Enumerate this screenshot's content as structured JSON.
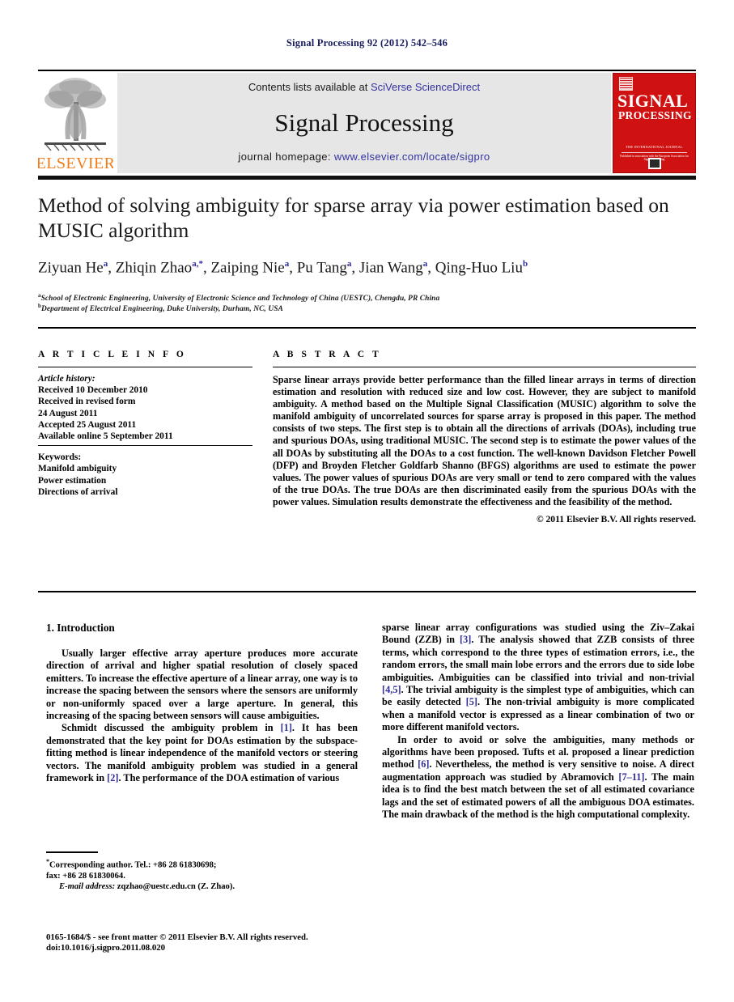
{
  "running_head": "Signal Processing 92 (2012) 542–546",
  "banner": {
    "publisher_word": "ELSEVIER",
    "contents_prefix": "Contents lists available at ",
    "contents_link": "SciVerse ScienceDirect",
    "journal_name": "Signal Processing",
    "homepage_prefix": "journal homepage: ",
    "homepage_url": "www.elsevier.com/locate/sigpro",
    "cover": {
      "title_line1": "SIGNAL",
      "title_line2": "PROCESSING",
      "sub_line1": "THE INTERNATIONAL JOURNAL",
      "sub_line2": "Published in association with the European Association for Signal Processing"
    },
    "link_color": "#3232a0",
    "cover_color": "#cf1111",
    "elsevier_orange": "#f07d1a"
  },
  "article": {
    "title": "Method of solving ambiguity for sparse array via power estimation based on MUSIC algorithm",
    "authors": [
      {
        "name": "Ziyuan He",
        "marks": "a"
      },
      {
        "name": "Zhiqin Zhao",
        "marks": "a,*"
      },
      {
        "name": "Zaiping Nie",
        "marks": "a"
      },
      {
        "name": "Pu Tang",
        "marks": "a"
      },
      {
        "name": "Jian Wang",
        "marks": "a"
      },
      {
        "name": "Qing-Huo Liu",
        "marks": "b"
      }
    ],
    "affiliations": [
      {
        "mark": "a",
        "text": "School of Electronic Engineering, University of Electronic Science and Technology of China (UESTC), Chengdu, PR China"
      },
      {
        "mark": "b",
        "text": "Department of Electrical Engineering, Duke University, Durham, NC, USA"
      }
    ]
  },
  "info": {
    "heading": "A R T I C L E  I N F O",
    "history_label": "Article history:",
    "history": [
      "Received 10 December 2010",
      "Received in revised form",
      "24 August 2011",
      "Accepted 25 August 2011",
      "Available online 5 September 2011"
    ],
    "keywords_label": "Keywords:",
    "keywords": [
      "Manifold ambiguity",
      "Power estimation",
      "Directions of arrival"
    ]
  },
  "abstract": {
    "heading": "A B S T R A C T",
    "text": "Sparse linear arrays provide better performance than the filled linear arrays in terms of direction estimation and resolution with reduced size and low cost. However, they are subject to manifold ambiguity. A method based on the Multiple Signal Classification (MUSIC) algorithm to solve the manifold ambiguity of uncorrelated sources for sparse array is proposed in this paper. The method consists of two steps. The first step is to obtain all the directions of arrivals (DOAs), including true and spurious DOAs, using traditional MUSIC. The second step is to estimate the power values of the all DOAs by substituting all the DOAs to a cost function. The well-known Davidson Fletcher Powell (DFP) and Broyden Fletcher Goldfarb Shanno (BFGS) algorithms are used to estimate the power values. The power values of spurious DOAs are very small or tend to zero compared with the values of the true DOAs. The true DOAs are then discriminated easily from the spurious DOAs with the power values. Simulation results demonstrate the effectiveness and the feasibility of the method.",
    "copyright": "© 2011 Elsevier B.V. All rights reserved."
  },
  "body": {
    "section_number_title": "1.  Introduction",
    "left_paragraphs": [
      "Usually larger effective array aperture produces more accurate direction of arrival and higher spatial resolution of closely spaced emitters. To increase the effective aperture of a linear array, one way is to increase the spacing between the sensors where the sensors are uniformly or non-uniformly spaced over a large aperture. In general, this increasing of the spacing between sensors will cause ambiguities."
    ],
    "left_paragraph_2_parts": {
      "a": "Schmidt discussed the ambiguity problem in ",
      "ref1": "[1]",
      "b": ". It has been demonstrated that the key point for DOAs estimation by the subspace-fitting method is linear independence of the manifold vectors or steering vectors. The manifold ambiguity problem was studied in a general framework in ",
      "ref2": "[2]",
      "c": ". The performance of the DOA estimation of various"
    },
    "right_paragraph_1_parts": {
      "a": "sparse linear array configurations was studied using the Ziv–Zakai Bound (ZZB) in ",
      "ref3": "[3]",
      "b": ". The analysis showed that ZZB consists of three terms, which correspond to the three types of estimation errors, i.e., the random errors, the small main lobe errors and the errors due to side lobe ambiguities. Ambiguities can be classified into trivial and non-trivial ",
      "ref45": "[4,5]",
      "c": ". The trivial ambiguity is the simplest type of ambiguities, which can be easily detected ",
      "ref5": "[5]",
      "d": ". The non-trivial ambiguity is more complicated when a manifold vector is expressed as a linear combination of two or more different manifold vectors."
    },
    "right_paragraph_2_parts": {
      "a": "In order to avoid or solve the ambiguities, many methods or algorithms have been proposed. Tufts et al. proposed a linear prediction method ",
      "ref6": "[6]",
      "b": ". Nevertheless, the method is very sensitive to noise. A direct augmentation approach was studied by Abramovich ",
      "ref711": "[7–11]",
      "c": ". The main idea is to find the best match between the set of all estimated covariance lags and the set of estimated powers of all the ambiguous DOA estimates. The main drawback of the method is the high computational complexity."
    }
  },
  "footnotes": {
    "corresponding_line1": "Corresponding author. Tel.: +86 28 61830698;",
    "corresponding_line2": "fax: +86 28 61830064.",
    "email_label": "E-mail address:",
    "email_value": " zqzhao@uestc.edu.cn (Z. Zhao).",
    "issn_line1": "0165-1684/$ - see front matter © 2011 Elsevier B.V. All rights reserved.",
    "issn_line2": "doi:10.1016/j.sigpro.2011.08.020"
  }
}
